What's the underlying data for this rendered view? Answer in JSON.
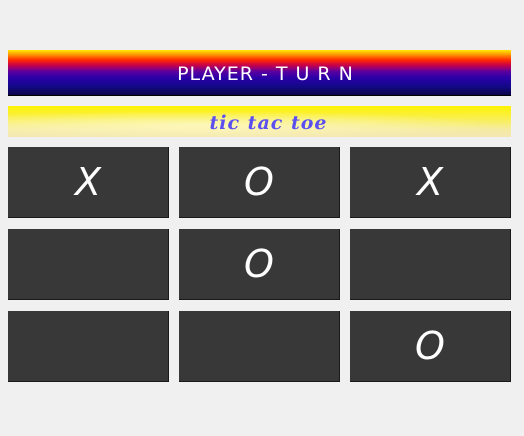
{
  "header": {
    "turn_text": "PLAYER - T U R N"
  },
  "subtitle": {
    "text": "tic tac toe"
  },
  "board": {
    "cells": [
      [
        "X",
        "O",
        "X"
      ],
      [
        "",
        "O",
        ""
      ],
      [
        "",
        "",
        "O"
      ]
    ]
  },
  "colors": {
    "background": "#f0f0f0",
    "cell": "#383838",
    "mark": "#ffffff",
    "subtitle_text": "#5b4ff0"
  }
}
